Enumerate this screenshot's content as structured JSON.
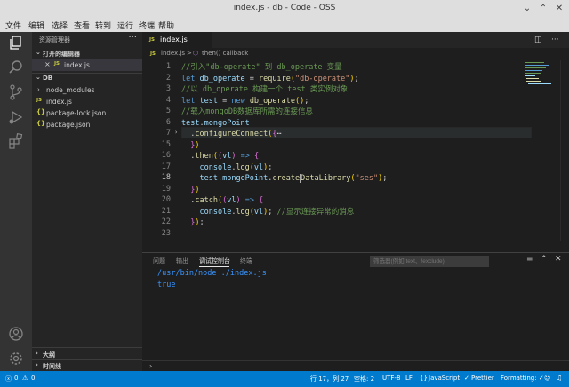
{
  "window": {
    "title": "index.js - db - Code - OSS"
  },
  "menu": [
    "文件",
    "编辑",
    "选择",
    "查看",
    "转到",
    "运行",
    "终端",
    "帮助"
  ],
  "sidebar": {
    "title": "资源管理器",
    "open_editors": {
      "label": "打开的编辑器",
      "items": [
        {
          "badge": "JS",
          "name": "index.js"
        }
      ]
    },
    "folder": {
      "label": "DB",
      "items": [
        {
          "kind": "folder",
          "name": "node_modules"
        },
        {
          "badge": "JS",
          "name": "index.js"
        },
        {
          "badge": "{}",
          "name": "package-lock.json"
        },
        {
          "badge": "{}",
          "name": "package.json"
        }
      ]
    },
    "outline_label": "大纲",
    "timeline_label": "时间线"
  },
  "tab": {
    "badge": "JS",
    "name": "index.js"
  },
  "breadcrumb": {
    "file": "index.js",
    "sep": ">",
    "symbol": "then() callback"
  },
  "editor": {
    "lines": [
      {
        "n": "1",
        "parts": [
          [
            "cm",
            "//引入\"db-operate\" 到 db_operate 变量"
          ]
        ]
      },
      {
        "n": "2",
        "parts": [
          [
            "kw",
            "let "
          ],
          [
            "vr",
            "db_operate"
          ],
          [
            "pl",
            " = "
          ],
          [
            "fn",
            "require"
          ],
          [
            "br",
            "("
          ],
          [
            "st",
            "\"db-operate\""
          ],
          [
            "br",
            ")"
          ],
          [
            "pl",
            ";"
          ]
        ]
      },
      {
        "n": "3",
        "parts": [
          [
            "cm",
            "//以 db_operate 构建一个 test 类实例对象"
          ]
        ]
      },
      {
        "n": "4",
        "parts": [
          [
            "kw",
            "let "
          ],
          [
            "vr",
            "test"
          ],
          [
            "pl",
            " = "
          ],
          [
            "kw",
            "new "
          ],
          [
            "fn",
            "db_operate"
          ],
          [
            "br",
            "()"
          ],
          [
            "pl",
            ";"
          ]
        ]
      },
      {
        "n": "5",
        "parts": [
          [
            "cm",
            "//载入mongoDB数据库所需的连接信息"
          ]
        ]
      },
      {
        "n": "6",
        "parts": [
          [
            "vr",
            "test"
          ],
          [
            "pl",
            "."
          ],
          [
            "vr",
            "mongoPoint"
          ]
        ]
      },
      {
        "n": "7",
        "parts": [
          [
            "pl",
            "  ."
          ],
          [
            "fn",
            "configureConnect"
          ],
          [
            "br",
            "("
          ],
          [
            "br2",
            "{"
          ],
          [
            "pl",
            "⋯"
          ]
        ],
        "fold": "›"
      },
      {
        "n": "15",
        "parts": [
          [
            "pl",
            "  "
          ],
          [
            "br2",
            "}"
          ],
          [
            "br",
            ")"
          ]
        ]
      },
      {
        "n": "16",
        "parts": [
          [
            "pl",
            "  ."
          ],
          [
            "fn",
            "then"
          ],
          [
            "br",
            "("
          ],
          [
            "br2",
            "("
          ],
          [
            "vr",
            "vl"
          ],
          [
            "br2",
            ")"
          ],
          [
            "kw",
            " => "
          ],
          [
            "br2",
            "{"
          ]
        ]
      },
      {
        "n": "17",
        "parts": [
          [
            "pl",
            "    "
          ],
          [
            "vr",
            "console"
          ],
          [
            "pl",
            "."
          ],
          [
            "fn",
            "log"
          ],
          [
            "br",
            "("
          ],
          [
            "vr",
            "vl"
          ],
          [
            "br",
            ")"
          ],
          [
            "pl",
            ";"
          ]
        ]
      },
      {
        "n": "18",
        "parts": [
          [
            "pl",
            "    "
          ],
          [
            "vr",
            "test"
          ],
          [
            "pl",
            "."
          ],
          [
            "vr",
            "mongoPoint"
          ],
          [
            "pl",
            "."
          ],
          [
            "fn",
            "create"
          ],
          [
            "cursor",
            ""
          ],
          [
            "fn",
            "DataLibrary"
          ],
          [
            "br",
            "("
          ],
          [
            "st",
            "\"ses\""
          ],
          [
            "br",
            ")"
          ],
          [
            "pl",
            ";"
          ]
        ],
        "current": true
      },
      {
        "n": "19",
        "parts": [
          [
            "pl",
            "  "
          ],
          [
            "br2",
            "}"
          ],
          [
            "br",
            ")"
          ]
        ]
      },
      {
        "n": "20",
        "parts": [
          [
            "pl",
            "  ."
          ],
          [
            "fn",
            "catch"
          ],
          [
            "br",
            "("
          ],
          [
            "br2",
            "("
          ],
          [
            "vr",
            "vl"
          ],
          [
            "br2",
            ")"
          ],
          [
            "kw",
            " => "
          ],
          [
            "br2",
            "{"
          ]
        ]
      },
      {
        "n": "21",
        "parts": [
          [
            "pl",
            "    "
          ],
          [
            "vr",
            "console"
          ],
          [
            "pl",
            "."
          ],
          [
            "fn",
            "log"
          ],
          [
            "br",
            "("
          ],
          [
            "vr",
            "vl"
          ],
          [
            "br",
            ")"
          ],
          [
            "pl",
            "; "
          ],
          [
            "cm",
            "//显示连接异常的消息"
          ]
        ]
      },
      {
        "n": "22",
        "parts": [
          [
            "pl",
            "  "
          ],
          [
            "br2",
            "}"
          ],
          [
            "br",
            ")"
          ],
          [
            "pl",
            ";"
          ]
        ]
      },
      {
        "n": "23",
        "parts": []
      }
    ]
  },
  "panel": {
    "tabs": [
      "问题",
      "输出",
      "调试控制台",
      "终端"
    ],
    "active_tab": 2,
    "filter_placeholder": "筛选器(例如 text、!exclude)",
    "lines": [
      "/usr/bin/node ./index.js",
      "true"
    ],
    "prompt": "›"
  },
  "status": {
    "errors": "0",
    "warnings": "0",
    "position": "行 17，列 27",
    "indent": "空格: 2",
    "encoding": "UTF-8",
    "eol": "LF",
    "language": "JavaScript",
    "linter": "Prettier",
    "formatting": "Formatting: ✓"
  },
  "colors": {
    "accent": "#007acc",
    "sidebar": "#252526",
    "editor": "#1e1e1e",
    "activitybar": "#333333"
  }
}
